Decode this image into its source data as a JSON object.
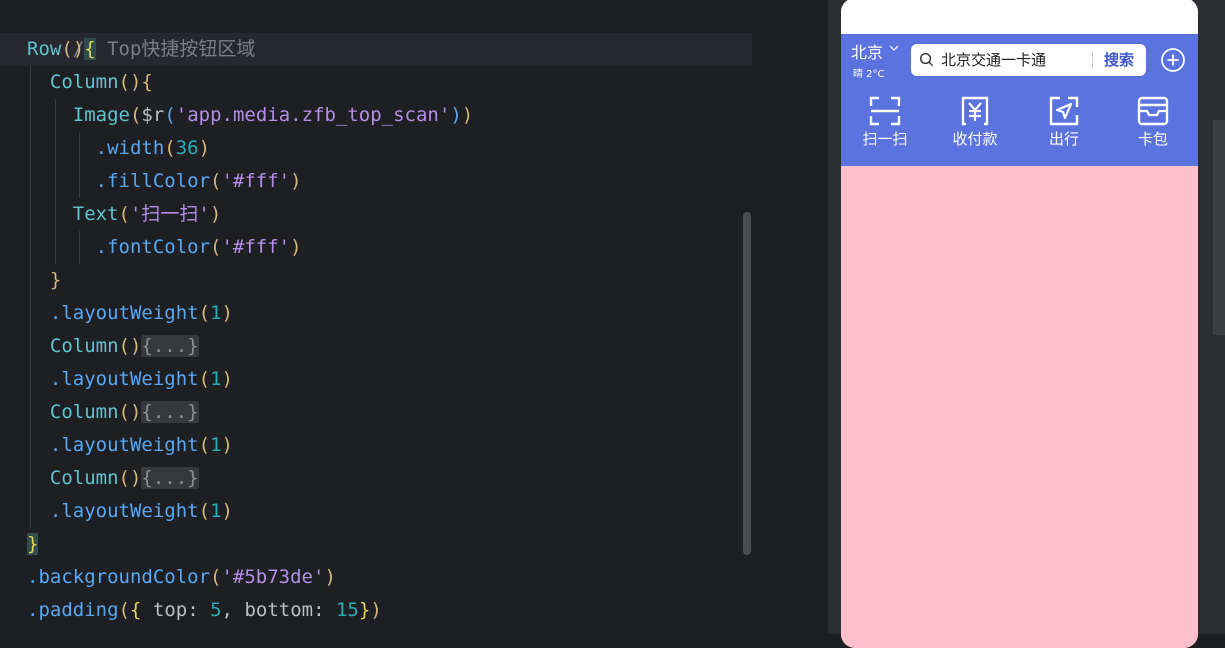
{
  "editor": {
    "line1_comment": "// Top快捷按钮区域",
    "row_fn": "Row",
    "column_fn": "Column",
    "image_fn": "Image",
    "image_arg_prefix": "$r",
    "image_arg_string": "'app.media.zfb_top_scan'",
    "width_method": ".width",
    "width_value": "36",
    "fillcolor_method": ".fillColor",
    "fillcolor_value": "'#fff'",
    "text_fn": "Text",
    "text_value": "'扫一扫'",
    "fontcolor_method": ".fontColor",
    "fontcolor_value": "'#fff'",
    "layoutweight_method": ".layoutWeight",
    "layoutweight_value": "1",
    "folded_block": "{...}",
    "bg_method": ".backgroundColor",
    "bg_value": "'#5b73de'",
    "padding_method": ".padding",
    "padding_top_key": "top",
    "padding_top_value": "5",
    "padding_bottom_key": "bottom",
    "padding_bottom_value": "15"
  },
  "phone": {
    "city": "北京",
    "weather": "晴 2°C",
    "search_text": "北京交通一卡通",
    "search_button": "搜索",
    "quick_actions": [
      {
        "label": "扫一扫",
        "icon": "scan-icon"
      },
      {
        "label": "收付款",
        "icon": "payment-icon"
      },
      {
        "label": "出行",
        "icon": "travel-icon"
      },
      {
        "label": "卡包",
        "icon": "card-wallet-icon"
      }
    ],
    "colors": {
      "top_bar": "#5b73de",
      "content_bg": "#ffc0cb",
      "search_button": "#3d57cc"
    }
  }
}
